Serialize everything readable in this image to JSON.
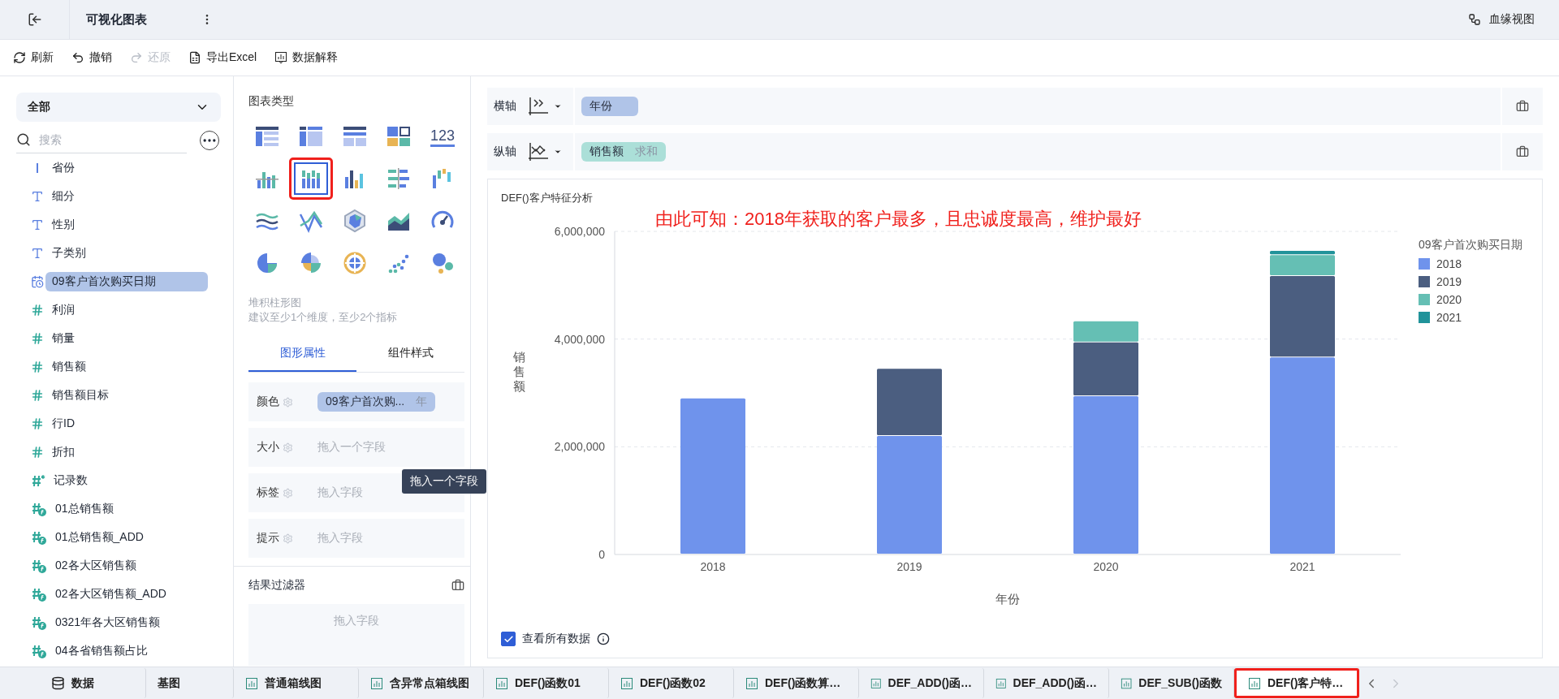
{
  "header": {
    "title": "可视化图表",
    "lineage": "血缘视图"
  },
  "toolbar": [
    {
      "kind": "refresh",
      "label": "刷新",
      "disabled": false
    },
    {
      "kind": "undo",
      "label": "撤销",
      "disabled": false
    },
    {
      "kind": "redo",
      "label": "还原",
      "disabled": true
    },
    {
      "kind": "export",
      "label": "导出Excel",
      "disabled": false
    },
    {
      "kind": "explain",
      "label": "数据解释",
      "disabled": false
    }
  ],
  "fields_panel": {
    "scope": "全部",
    "search": {
      "placeholder": "搜索"
    },
    "fields": [
      {
        "kind": "geo",
        "name": "省份",
        "selected": false
      },
      {
        "kind": "text",
        "name": "细分",
        "selected": false
      },
      {
        "kind": "text",
        "name": "性别",
        "selected": false
      },
      {
        "kind": "text",
        "name": "子类别",
        "selected": false
      },
      {
        "kind": "date",
        "name": "09客户首次购买日期",
        "selected": true
      },
      {
        "kind": "number",
        "name": "利润",
        "selected": false
      },
      {
        "kind": "number",
        "name": "销量",
        "selected": false
      },
      {
        "kind": "number",
        "name": "销售额",
        "selected": false
      },
      {
        "kind": "number",
        "name": "销售额目标",
        "selected": false
      },
      {
        "kind": "number",
        "name": "行ID",
        "selected": false
      },
      {
        "kind": "number",
        "name": "折扣",
        "selected": false
      },
      {
        "kind": "count",
        "name": "记录数",
        "selected": false
      },
      {
        "kind": "calc",
        "name": "01总销售额",
        "selected": false
      },
      {
        "kind": "calc",
        "name": "01总销售额_ADD",
        "selected": false
      },
      {
        "kind": "calc",
        "name": "02各大区销售额",
        "selected": false
      },
      {
        "kind": "calc",
        "name": "02各大区销售额_ADD",
        "selected": false
      },
      {
        "kind": "calc",
        "name": "0321年各大区销售额",
        "selected": false
      },
      {
        "kind": "calc",
        "name": "04各省销售额占比",
        "selected": false
      }
    ]
  },
  "chart_types": {
    "title": "图表类型",
    "items": [
      {
        "kind": "table",
        "selected": false,
        "highlighted": false
      },
      {
        "kind": "crosstable",
        "selected": false,
        "highlighted": false
      },
      {
        "kind": "detail",
        "selected": false,
        "highlighted": false
      },
      {
        "kind": "blocks",
        "selected": false,
        "highlighted": false
      },
      {
        "kind": "number",
        "label": "123",
        "selected": false,
        "highlighted": false
      },
      {
        "kind": "group-bar",
        "selected": false,
        "highlighted": false
      },
      {
        "kind": "stacked-bar",
        "selected": true,
        "highlighted": true
      },
      {
        "kind": "bar",
        "selected": false,
        "highlighted": false
      },
      {
        "kind": "hbar",
        "selected": false,
        "highlighted": false
      },
      {
        "kind": "waterfall",
        "selected": false,
        "highlighted": false
      },
      {
        "kind": "multi-line",
        "selected": false,
        "highlighted": false
      },
      {
        "kind": "line",
        "selected": false,
        "highlighted": false
      },
      {
        "kind": "radar",
        "selected": false,
        "highlighted": false
      },
      {
        "kind": "area",
        "selected": false,
        "highlighted": false
      },
      {
        "kind": "gauge",
        "selected": false,
        "highlighted": false
      },
      {
        "kind": "pie",
        "selected": false,
        "highlighted": false
      },
      {
        "kind": "rose",
        "selected": false,
        "highlighted": false
      },
      {
        "kind": "sunburst",
        "selected": false,
        "highlighted": false
      },
      {
        "kind": "scatter",
        "selected": false,
        "highlighted": false
      },
      {
        "kind": "bubble",
        "selected": false,
        "highlighted": false
      }
    ],
    "description": "堆积柱形图",
    "hint": "建议至少1个维度，至少2个指标"
  },
  "property_tabs": [
    {
      "label": "图形属性",
      "selected": true
    },
    {
      "label": "组件样式",
      "selected": false
    }
  ],
  "properties": [
    {
      "label": "颜色",
      "chip": "09客户首次购...",
      "chip_suffix": "年"
    },
    {
      "label": "大小",
      "placeholder": "拖入一个字段"
    },
    {
      "label": "标签",
      "placeholder": "拖入字段"
    },
    {
      "label": "提示",
      "placeholder": "拖入字段"
    }
  ],
  "tooltip": "拖入一个字段",
  "result_filter": {
    "title": "结果过滤器",
    "placeholder": "拖入字段"
  },
  "axes": [
    {
      "kind": "x",
      "label": "横轴",
      "chip": "年份"
    },
    {
      "kind": "y",
      "label": "纵轴",
      "chip": "销售额",
      "chip_suffix": "求和"
    }
  ],
  "chart_card": {
    "title": "DEF()客户特征分析",
    "annotation": "由此可知：2018年获取的客户最多，且忠诚度最高，维护最好",
    "chart_data": {
      "type": "bar",
      "stacked": true,
      "xlabel": "年份",
      "ylabel": "销售额",
      "legend_title": "09客户首次购买日期",
      "categories": [
        "2018",
        "2019",
        "2020",
        "2021"
      ],
      "ylim": [
        0,
        6000000
      ],
      "yticks": [
        {
          "value": 0,
          "label": "0"
        },
        {
          "value": 2000000,
          "label": "2,000,000"
        },
        {
          "value": 4000000,
          "label": "4,000,000"
        },
        {
          "value": 6000000,
          "label": "6,000,000"
        }
      ],
      "series": [
        {
          "name": "2018",
          "color": "#6f93ec",
          "values": [
            2900000,
            2200000,
            2940000,
            3660000
          ]
        },
        {
          "name": "2019",
          "color": "#4b5e80",
          "values": [
            null,
            1250000,
            1000000,
            1510000
          ]
        },
        {
          "name": "2020",
          "color": "#65bfb4",
          "values": [
            null,
            null,
            390000,
            390000
          ]
        },
        {
          "name": "2021",
          "color": "#21939a",
          "values": [
            null,
            null,
            null,
            80000
          ]
        }
      ]
    },
    "show_all": {
      "label": "查看所有数据",
      "checked": true
    }
  },
  "sheet_tabs": [
    {
      "kind": "data",
      "label": "数据",
      "selected": false,
      "highlighted": false
    },
    {
      "kind": "partial",
      "label": "基图",
      "selected": false,
      "highlighted": false
    },
    {
      "kind": "chart",
      "label": "普通箱线图",
      "selected": false,
      "highlighted": false
    },
    {
      "kind": "chart",
      "label": "含异常点箱线图",
      "selected": false,
      "highlighted": false
    },
    {
      "kind": "chart",
      "label": "DEF()函数01",
      "selected": false,
      "highlighted": false
    },
    {
      "kind": "chart",
      "label": "DEF()函数02",
      "selected": false,
      "highlighted": false
    },
    {
      "kind": "chart",
      "label": "DEF()函数算…",
      "selected": false,
      "highlighted": false
    },
    {
      "kind": "chart",
      "label": "DEF_ADD()函…",
      "selected": false,
      "highlighted": false
    },
    {
      "kind": "chart",
      "label": "DEF_ADD()函…",
      "selected": false,
      "highlighted": false
    },
    {
      "kind": "chart",
      "label": "DEF_SUB()函数",
      "selected": false,
      "highlighted": false
    },
    {
      "kind": "chart",
      "label": "DEF()客户特…",
      "selected": true,
      "highlighted": true
    }
  ]
}
